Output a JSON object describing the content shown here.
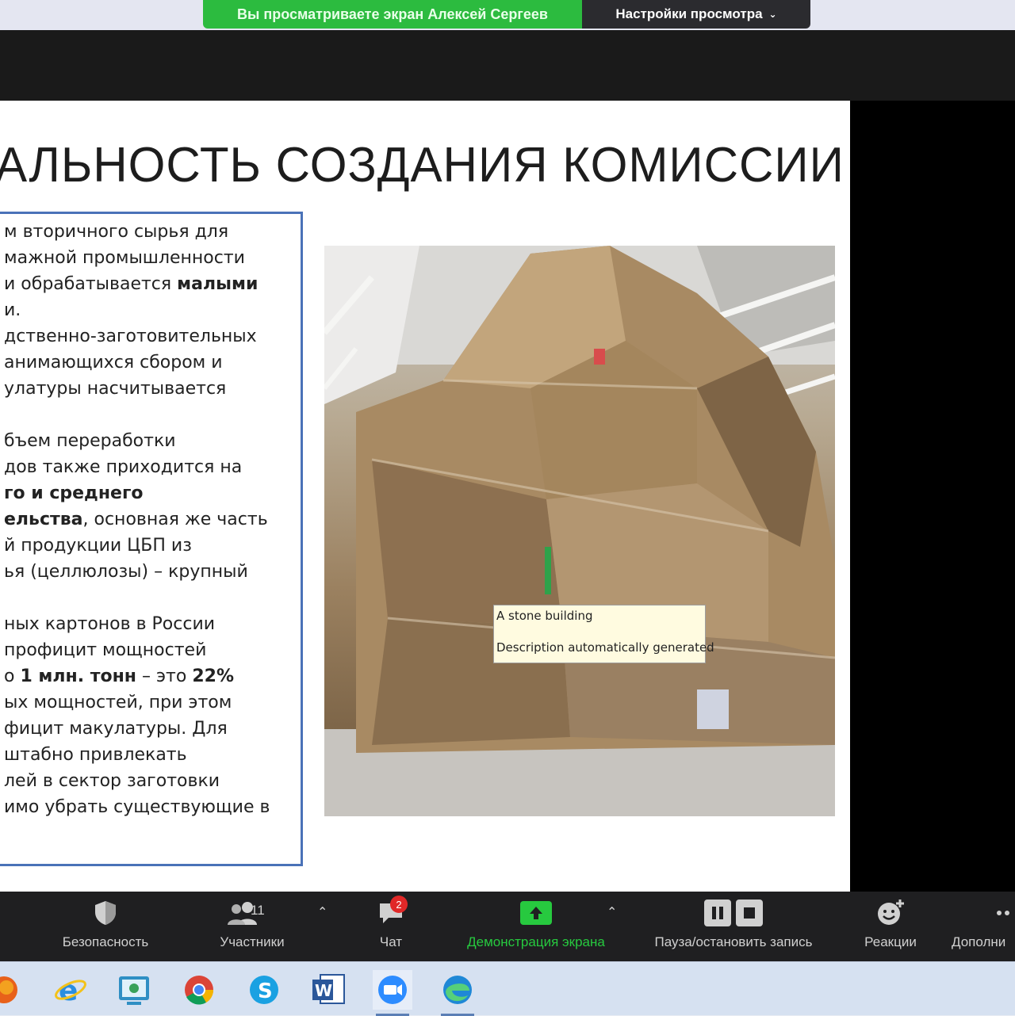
{
  "banner": {
    "sharing_text": "Вы просматриваете экран Алексей Сергеев",
    "view_options_label": "Настройки просмотра"
  },
  "slide": {
    "title": "АЛЬНОСТЬ СОЗДАНИЯ КОМИССИИ",
    "lines": [
      {
        "segments": [
          {
            "text": "м вторичного сырья для",
            "bold": false
          }
        ]
      },
      {
        "segments": [
          {
            "text": "мажной промышленности",
            "bold": false
          }
        ]
      },
      {
        "segments": [
          {
            "text": " и обрабатывается ",
            "bold": false
          },
          {
            "text": "малыми",
            "bold": true
          }
        ]
      },
      {
        "segments": [
          {
            "text": "и.",
            "bold": false
          }
        ]
      },
      {
        "segments": [
          {
            "text": "дственно-заготовительных",
            "bold": false
          }
        ]
      },
      {
        "segments": [
          {
            "text": "анимающихся сбором и",
            "bold": false
          }
        ]
      },
      {
        "segments": [
          {
            "text": "улатуры насчитывается",
            "bold": false
          }
        ]
      },
      {
        "segments": [
          {
            "text": "",
            "bold": false
          }
        ]
      },
      {
        "segments": [
          {
            "text": "бъем переработки",
            "bold": false
          }
        ]
      },
      {
        "segments": [
          {
            "text": "дов также приходится на",
            "bold": false
          }
        ]
      },
      {
        "segments": [
          {
            "text": "го и среднего",
            "bold": true
          }
        ]
      },
      {
        "segments": [
          {
            "text": "ельства",
            "bold": true
          },
          {
            "text": ", основная же часть",
            "bold": false
          }
        ]
      },
      {
        "segments": [
          {
            "text": "й продукции ЦБП из",
            "bold": false
          }
        ]
      },
      {
        "segments": [
          {
            "text": "ья (целлюлозы) – крупный",
            "bold": false
          }
        ]
      },
      {
        "segments": [
          {
            "text": "",
            "bold": false
          }
        ]
      },
      {
        "segments": [
          {
            "text": "ных картонов в России",
            "bold": false
          }
        ]
      },
      {
        "segments": [
          {
            "text": " профицит мощностей",
            "bold": false
          }
        ]
      },
      {
        "segments": [
          {
            "text": "о ",
            "bold": false
          },
          {
            "text": "1 млн. тонн",
            "bold": true
          },
          {
            "text": " – это ",
            "bold": false
          },
          {
            "text": "22%",
            "bold": true
          }
        ]
      },
      {
        "segments": [
          {
            "text": "ых мощностей, при этом",
            "bold": false
          }
        ]
      },
      {
        "segments": [
          {
            "text": "фицит макулатуры. Для",
            "bold": false
          }
        ]
      },
      {
        "segments": [
          {
            "text": "штабно привлекать",
            "bold": false
          }
        ]
      },
      {
        "segments": [
          {
            "text": "лей в сектор заготовки",
            "bold": false
          }
        ]
      },
      {
        "segments": [
          {
            "text": "имо убрать существующие в",
            "bold": false
          }
        ]
      }
    ],
    "tooltip": {
      "line1": "A stone building",
      "line2": "Description automatically generated"
    }
  },
  "toolbar": {
    "security_label": "Безопасность",
    "participants_label": "Участники",
    "participants_count": "11",
    "chat_label": "Чат",
    "chat_badge": "2",
    "share_label": "Демонстрация экрана",
    "record_label": "Пауза/остановить запись",
    "reactions_label": "Реакции",
    "more_label": "Дополни"
  },
  "colors": {
    "share_green": "#2cbb3f",
    "toolbar_bg": "#1f1f21",
    "textbox_border": "#4a72b8",
    "chat_badge": "#e02828"
  },
  "taskbar": {
    "apps": [
      "firefox-icon",
      "internet-explorer-icon",
      "screen-capture-icon",
      "chrome-icon",
      "skype-icon",
      "word-icon",
      "zoom-icon",
      "edge-icon"
    ]
  }
}
